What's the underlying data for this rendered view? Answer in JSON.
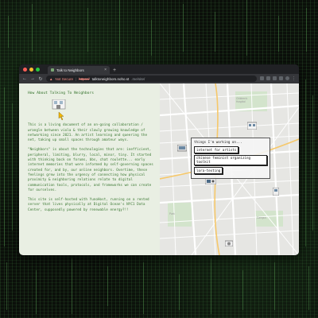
{
  "browser": {
    "tab_title": "Talk to Neighbors",
    "new_tab_symbol": "+",
    "security_label": "Not Secure",
    "url_scheme": "https://",
    "url_host": "talktoneighbors.noho.st",
    "url_path": ".me/site/",
    "traffic_lights": [
      "#ff5f57",
      "#febc2e",
      "#28c840"
    ]
  },
  "left_panel": {
    "heading": "How About Talking To Neighbors",
    "paragraphs": [
      "This is a living document of an on-going collaboration / wrangle between viola & their slowly growing knowledge of networking since 2021. An artist learning and queering the net, taking up small spaces through amateur ways.",
      "\"Neighbors\" is about the technologies that are: inefficient, peripheral, limiting, blurry, local, minor, tiny. It started with thinking back on forums, bbs, chat roulette... early internet memories that were informed by self-governing spaces created for, and by, our online neighbors. Overtime, these feelings grew into the urgency of connecting how physical proximity & neighboring relations relate to digital communication tools, protocols, and frameworks we can create for ourselves.",
      "This site is self-hosted with YunoHost, running on a rented server that lives physically at Digital Ocean's NYC1 Data Center, supposedly powered by renewable energy?!!"
    ]
  },
  "map_popup": {
    "title": "things I'm working on...",
    "items": [
      "internet for artists",
      "chinese feminist organizing toolkit",
      "lora-texting"
    ]
  },
  "colors": {
    "accent_green": "#3d7a35",
    "left_bg": "#e9efe3",
    "map_bg": "#e8e8e6"
  }
}
